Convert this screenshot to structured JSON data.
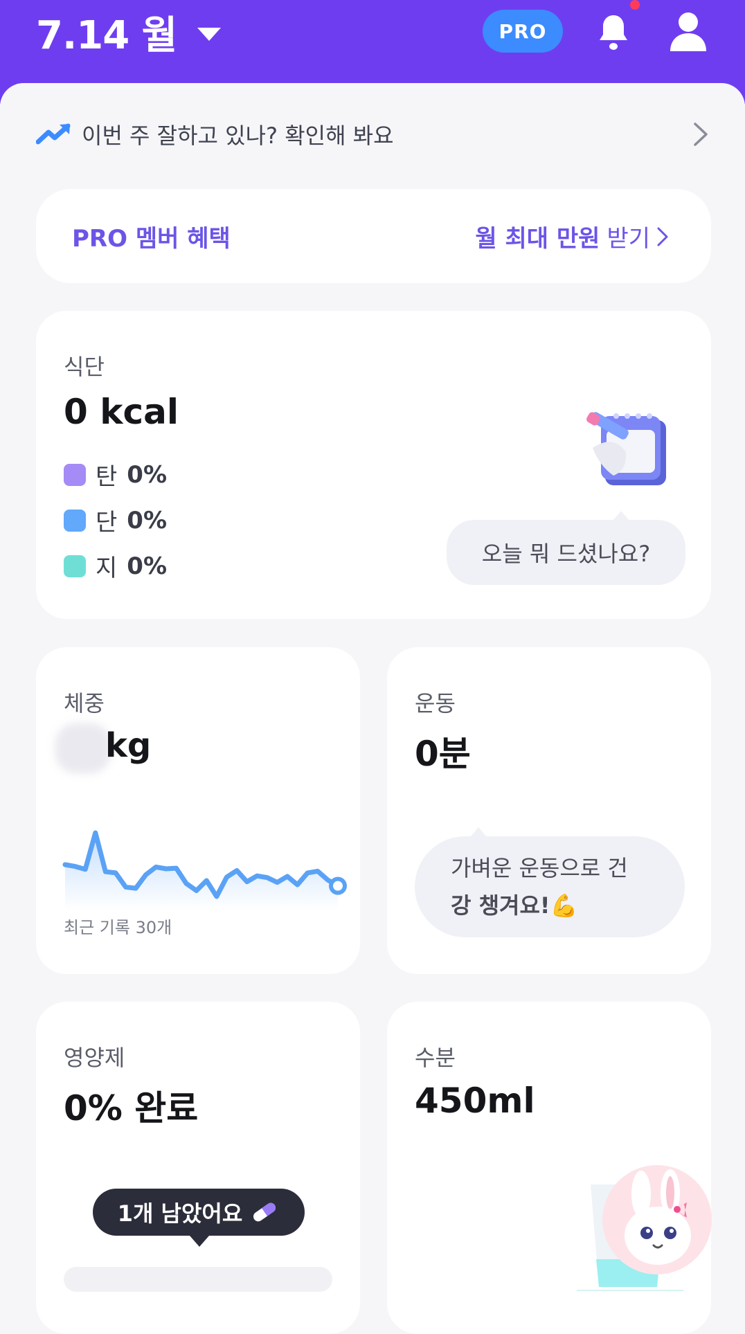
{
  "header": {
    "date": "7.14 월",
    "pro_badge": "PRO"
  },
  "weekly": {
    "text": "이번 주 잘하고 있나? 확인해 봐요"
  },
  "pro_banner": {
    "left": "PRO 멤버 혜택",
    "right_bold": "월 최대 만원",
    "right_light": "받기"
  },
  "diet": {
    "label": "식단",
    "value": "0 kcal",
    "macros": [
      {
        "name": "탄",
        "pct": "0%",
        "color": "#a58bf5"
      },
      {
        "name": "단",
        "pct": "0%",
        "color": "#62a8fb"
      },
      {
        "name": "지",
        "pct": "0%",
        "color": "#6fdfd6"
      }
    ],
    "bubble": "오늘 뭐 드셨나요?"
  },
  "weight": {
    "label": "체중",
    "unit": "kg",
    "caption": "최근 기록 30개",
    "trend": [
      44,
      41,
      36,
      98,
      32,
      30,
      6,
      4,
      27,
      40,
      37,
      38,
      12,
      0,
      17,
      -10,
      23,
      34,
      15,
      25,
      22,
      14,
      24,
      10,
      30,
      33,
      18,
      8
    ]
  },
  "exercise": {
    "label": "운동",
    "value": "0분",
    "bubble_line1": "가벼운 운동으로 건",
    "bubble_line2": "강 챙겨요!💪"
  },
  "supplement": {
    "label": "영양제",
    "value": "0% 완료",
    "remaining": "1개 남았어요",
    "progress": 0
  },
  "water": {
    "label": "수분",
    "value": "450ml"
  },
  "icons": {
    "bell": "bell-icon",
    "user": "user-icon",
    "trend": "trend-up-icon",
    "calendar": "calendar-pencil-icon",
    "pill": "pill-icon",
    "glass": "water-glass-icon",
    "mascot": "bunny-mascot-icon"
  },
  "colors": {
    "header": "#6f3df0",
    "pro_badge": "#3c8bff",
    "accent_text": "#6b55e8",
    "chart_line": "#5aa2f5"
  }
}
